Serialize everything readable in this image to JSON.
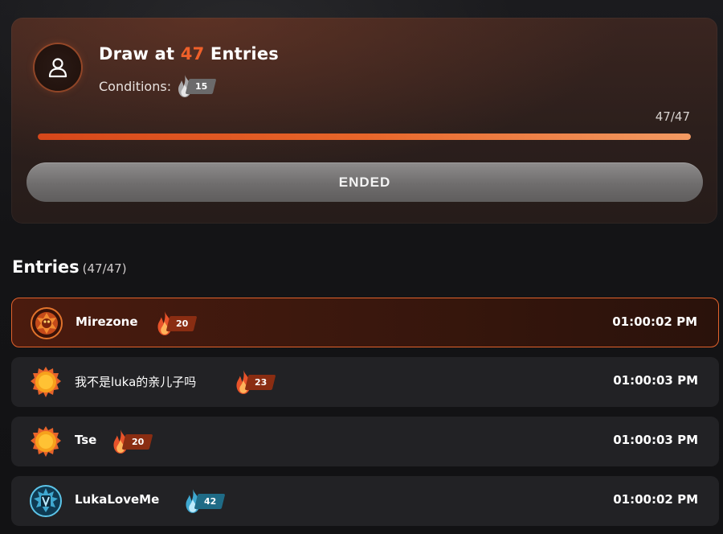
{
  "draw": {
    "title_prefix": "Draw at ",
    "title_number": "47",
    "title_suffix": " Entries",
    "conditions_label": "Conditions:",
    "conditions_level": "15",
    "progress_text": "47/47",
    "progress_fraction": 1.0,
    "button_label": "ENDED"
  },
  "entries": {
    "heading": "Entries",
    "count": "(47/47)",
    "items": [
      {
        "name": "Mirezone",
        "level": "20",
        "time": "01:00:02 PM",
        "badge_color": "#8a2d12",
        "flame_color": "#e8532a",
        "avatar": "fire-dragon"
      },
      {
        "name": "我不是luka的亲儿子吗",
        "level": "23",
        "time": "01:00:03 PM",
        "badge_color": "#8a2d12",
        "flame_color": "#e8532a",
        "avatar": "sun"
      },
      {
        "name": "Tse",
        "level": "20",
        "time": "01:00:03 PM",
        "badge_color": "#8a2d12",
        "flame_color": "#e8532a",
        "avatar": "sun"
      },
      {
        "name": "LukaLoveMe",
        "level": "42",
        "time": "01:00:02 PM",
        "badge_color": "#1f6b86",
        "flame_color": "#3fa8d0",
        "avatar": "blue-crest"
      }
    ]
  },
  "icons": {
    "draw_avatar": "user-icon",
    "level_badge": "flame-icon"
  },
  "colors": {
    "accent": "#f0602a",
    "highlight_border": "#e2622c",
    "condition_badge": "#6b6a6b"
  }
}
